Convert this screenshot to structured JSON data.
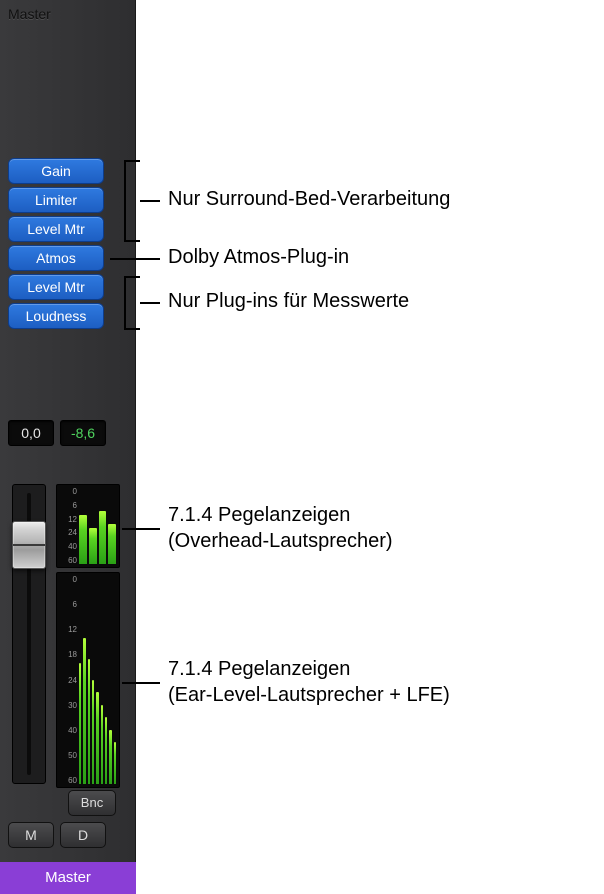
{
  "track": {
    "title": "Master",
    "bottom_label": "Master"
  },
  "plugins": [
    {
      "label": "Gain"
    },
    {
      "label": "Limiter"
    },
    {
      "label": "Level Mtr"
    },
    {
      "label": "Atmos"
    },
    {
      "label": "Level Mtr"
    },
    {
      "label": "Loudness"
    }
  ],
  "readouts": {
    "fader": "0,0",
    "peak": "-8,6"
  },
  "fader": {
    "pos_pct": 12
  },
  "meters": {
    "overhead": {
      "ticks": [
        "0",
        "6",
        "12",
        "24",
        "40",
        "60"
      ],
      "bars_pct": [
        65,
        48,
        70,
        52
      ]
    },
    "ear_level": {
      "ticks": [
        "0",
        "6",
        "12",
        "18",
        "24",
        "30",
        "40",
        "50",
        "60"
      ],
      "bars_pct": [
        58,
        70,
        60,
        50,
        44,
        38,
        32,
        26,
        20
      ]
    }
  },
  "buttons": {
    "bnc": "Bnc",
    "mute": "M",
    "dim": "D"
  },
  "annotations": {
    "bed": "Nur Surround-Bed-Verarbeitung",
    "atmos": "Dolby Atmos-Plug-in",
    "metering": "Nur Plug-ins für Messwerte",
    "meter_overhead_l1": "7.1.4 Pegelanzeigen",
    "meter_overhead_l2": "(Overhead-Lautsprecher)",
    "meter_ear_l1": "7.1.4 Pegelanzeigen",
    "meter_ear_l2": "(Ear-Level-Lautsprecher + LFE)"
  }
}
